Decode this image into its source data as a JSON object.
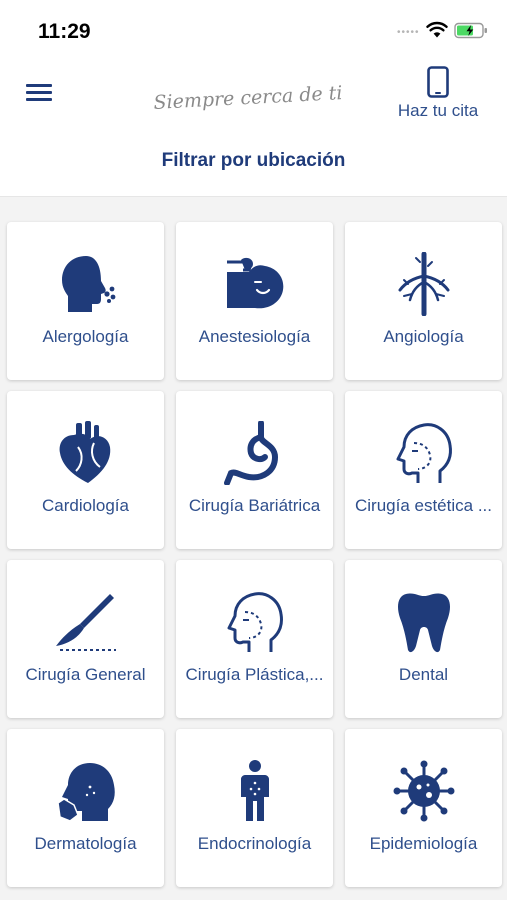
{
  "status_bar": {
    "time": "11:29",
    "signal_indicator": "•••••",
    "icons": [
      "wifi-icon",
      "battery-icon"
    ]
  },
  "header": {
    "menu_icon": "hamburger-menu-icon",
    "tagline": "Siempre cerca de ti",
    "appointment_label": "Haz tu cita",
    "appointment_icon": "phone-icon",
    "filter_label": "Filtrar por ubicación"
  },
  "colors": {
    "primary": "#1f3b7a",
    "label": "#2f4f8c",
    "background": "#f3f3f3",
    "card": "#ffffff"
  },
  "specialties": [
    {
      "label": "Alergología",
      "icon": "allergy-sneeze-icon"
    },
    {
      "label": "Anestesiología",
      "icon": "anesthesia-mask-icon"
    },
    {
      "label": "Angiología",
      "icon": "blood-vessel-icon"
    },
    {
      "label": "Cardiología",
      "icon": "heart-icon"
    },
    {
      "label": "Cirugía Bariátrica",
      "icon": "stomach-icon"
    },
    {
      "label": "Cirugía estética ...",
      "icon": "face-outline-icon"
    },
    {
      "label": "Cirugía General",
      "icon": "scalpel-icon"
    },
    {
      "label": "Cirugía Plástica,...",
      "icon": "face-outline-icon"
    },
    {
      "label": "Dental",
      "icon": "tooth-icon"
    },
    {
      "label": "Dermatología",
      "icon": "face-skin-icon"
    },
    {
      "label": "Endocrinología",
      "icon": "human-figure-icon"
    },
    {
      "label": "Epidemiología",
      "icon": "virus-icon"
    }
  ]
}
